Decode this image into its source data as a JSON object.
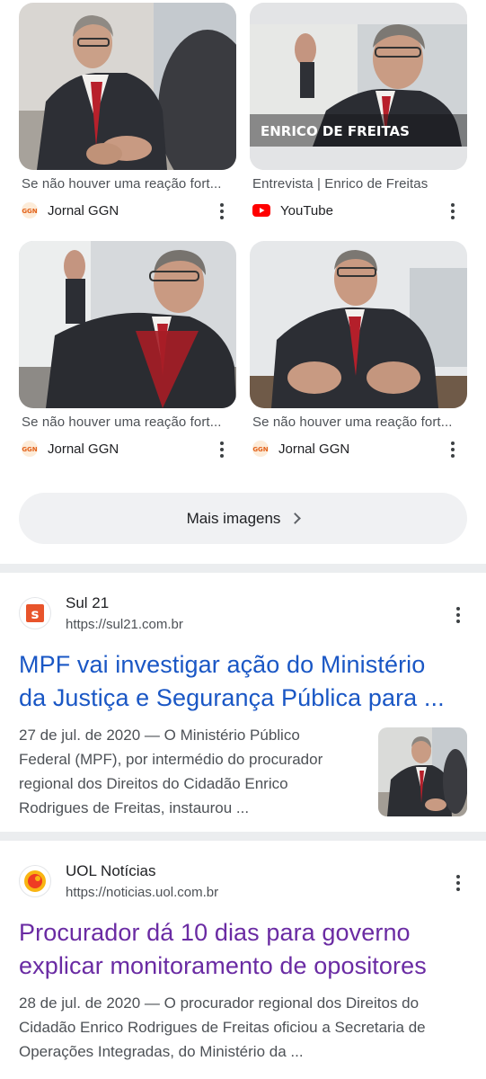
{
  "images": [
    {
      "caption": "Se não houver uma reação fort...",
      "source": "Jornal GGN",
      "source_icon": "ggn-logo-icon"
    },
    {
      "caption": "Entrevista | Enrico de Freitas",
      "source": "YouTube",
      "source_icon": "youtube-logo-icon",
      "overlay_text": "ENRICO DE FREITAS"
    },
    {
      "caption": "Se não houver uma reação fort...",
      "source": "Jornal GGN",
      "source_icon": "ggn-logo-icon"
    },
    {
      "caption": "Se não houver uma reação fort...",
      "source": "Jornal GGN",
      "source_icon": "ggn-logo-icon"
    }
  ],
  "more_images": {
    "label": "Mais imagens"
  },
  "results": [
    {
      "site_name": "Sul 21",
      "site_url": "https://sul21.com.br",
      "logo_letter": "s",
      "title_line1": "MPF vai investigar ação do Ministério",
      "title_line2": "da Justiça e Segurança Pública para ...",
      "snippet_lines": [
        "27 de jul. de 2020 — O Ministério Público",
        "Federal (MPF), por intermédio do procurador",
        "regional dos Direitos do Cidadão Enrico",
        "Rodrigues de Freitas, instaurou ..."
      ]
    },
    {
      "site_name": "UOL Notícias",
      "site_url": "https://noticias.uol.com.br",
      "title_line1": "Procurador dá 10 dias para governo",
      "title_line2": "explicar monitoramento de opositores",
      "snippet_lines": [
        "28 de jul. de 2020 — O procurador regional dos Direitos do",
        "Cidadão Enrico Rodrigues de Freitas oficiou a Secretaria de",
        "Operações Integradas, do Ministério da ..."
      ]
    }
  ],
  "colors": {
    "title_blue": "#1a57c5",
    "title_visited": "#6a2ba3",
    "sul21_orange": "#e8542b",
    "youtube_red": "#ff0000"
  }
}
